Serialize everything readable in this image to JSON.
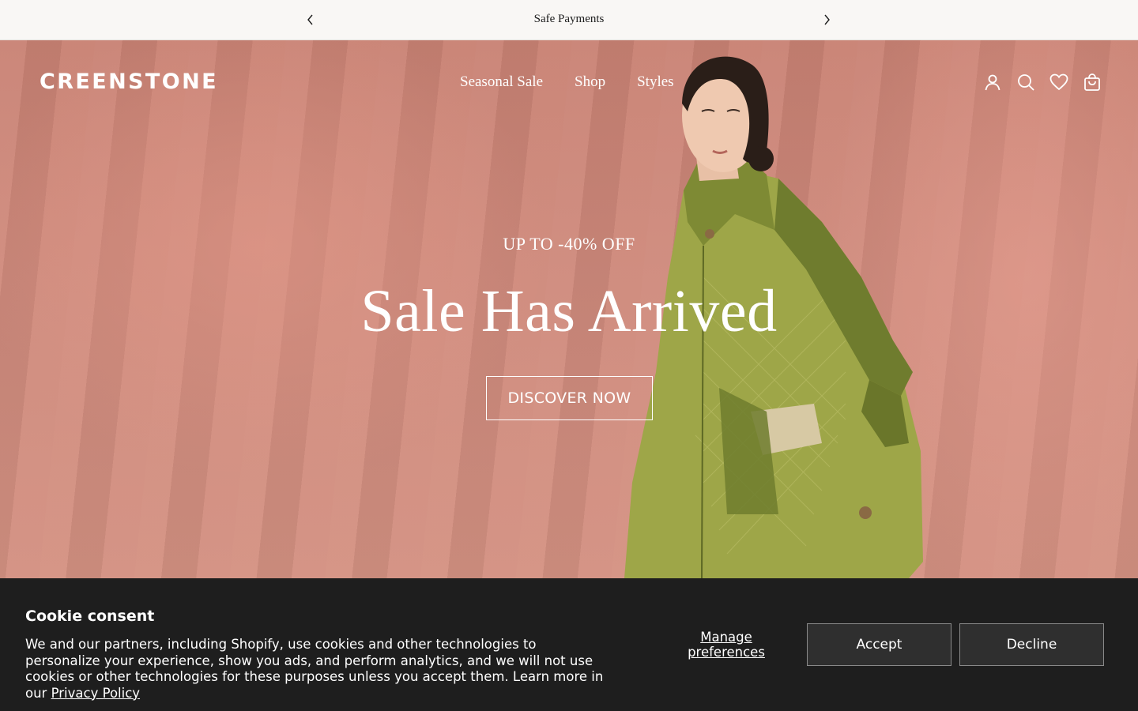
{
  "announcement": {
    "message": "Safe Payments",
    "prev_icon": "chevron-left-icon",
    "next_icon": "chevron-right-icon"
  },
  "header": {
    "logo": "CREENSTONE",
    "nav": [
      {
        "label": "Seasonal Sale"
      },
      {
        "label": "Shop"
      },
      {
        "label": "Styles"
      }
    ],
    "icons": [
      "account-icon",
      "search-icon",
      "wishlist-heart-icon",
      "cart-bag-icon"
    ]
  },
  "hero": {
    "eyebrow": "UP TO -40% OFF",
    "headline": "Sale Has Arrived",
    "cta_label": "DISCOVER NOW"
  },
  "cookie_banner": {
    "title": "Cookie consent",
    "body": "We and our partners, including Shopify, use cookies and other technologies to personalize your experience, show you ads, and perform analytics, and we will not use cookies or other technologies for these purposes unless you accept them. Learn more in our ",
    "privacy_link": "Privacy Policy",
    "manage_label": "Manage preferences",
    "accept_label": "Accept",
    "decline_label": "Decline"
  },
  "colors": {
    "announcement_bg": "#f9f7f5",
    "hero_bg": "#cf8a7c",
    "jacket_green": "#7c8838",
    "cookie_bg": "#1e1e1e",
    "button_bg": "#2f2f2f"
  }
}
